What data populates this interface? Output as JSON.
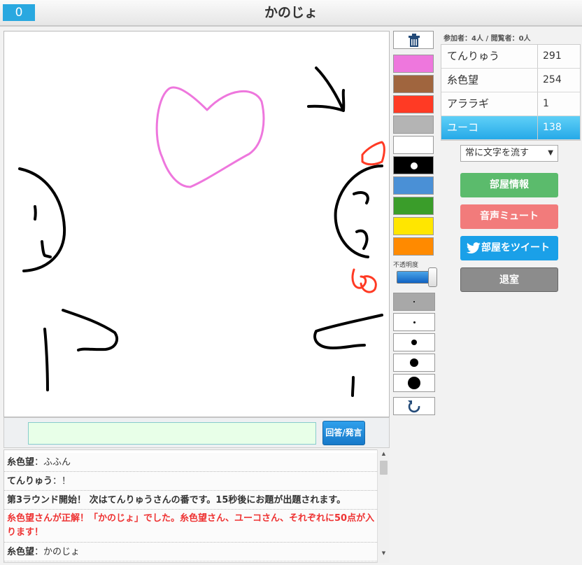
{
  "header": {
    "timer": "0",
    "word": "かのじょ"
  },
  "palette": {
    "colors": [
      "#ee77dd",
      "#a0653e",
      "#ff3a24",
      "#b4b4b4",
      "#ffffff",
      "#000000",
      "#4a90d6",
      "#3a9d2a",
      "#ffe600",
      "#ff8a00"
    ],
    "opacity_label": "不透明度",
    "opacity_value": 1.0,
    "brush_sizes": [
      2,
      3,
      8,
      12,
      18
    ],
    "selected_color_index": 5
  },
  "answer": {
    "button_label": "回答/発言",
    "input_value": ""
  },
  "chat": [
    {
      "name": "糸色望",
      "text": "：ふふん",
      "color": "#333"
    },
    {
      "name": "てんりゅう",
      "text": "：！",
      "color": "#333"
    },
    {
      "name": "",
      "text": "第3ラウンド開始！ 次はてんりゅうさんの番です。15秒後にお題が出題されます。",
      "color": "#333"
    },
    {
      "name": "",
      "text": "糸色望さんが正解！「かのじょ」でした。糸色望さん、ユーコさん、それぞれに50点が入ります！",
      "color": "#ee3333"
    },
    {
      "name": "糸色望",
      "text": "：かのじょ",
      "color": "#333"
    }
  ],
  "room": {
    "participants_label": "参加者：4人 / 閲覧者：0人",
    "players": [
      {
        "name": "てんりゅう",
        "score": "291"
      },
      {
        "name": "糸色望",
        "score": "254"
      },
      {
        "name": "アララギ",
        "score": "1"
      },
      {
        "name": "ユーコ",
        "score": "138"
      }
    ],
    "stream_option": "常に文字を流す",
    "buttons": {
      "room_info": "部屋情報",
      "mute": "音声ミュート",
      "tweet": "部屋をツイート",
      "leave": "退室"
    },
    "colors": {
      "room_info": "#5bbb6c",
      "mute": "#f27b7b",
      "tweet": "#1aa0e8",
      "leave": "#8c8c8c"
    }
  }
}
